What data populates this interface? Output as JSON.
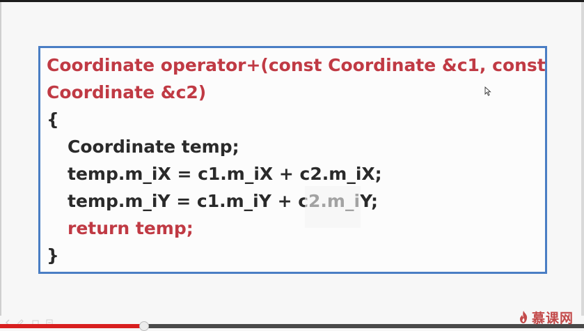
{
  "code": {
    "lines": [
      "Coordinate operator+(const Coordinate &c1, const",
      "Coordinate &c2)",
      "{",
      "Coordinate temp;",
      "temp.m_iX = c1.m_iX + c2.m_iX;",
      "temp.m_iY = c1.m_iY + c2.m_iY;",
      "return temp;",
      "}"
    ]
  },
  "player": {
    "progress_percent": 24.5,
    "watermark": "慕课网"
  },
  "colors": {
    "border": "#4a7ec4",
    "keyword_red": "#c03a44",
    "text": "#2a2a2a",
    "progress": "#d81f1f"
  },
  "icons": {
    "cursor": "mouse-cursor-icon",
    "brand": "flame-icon"
  }
}
